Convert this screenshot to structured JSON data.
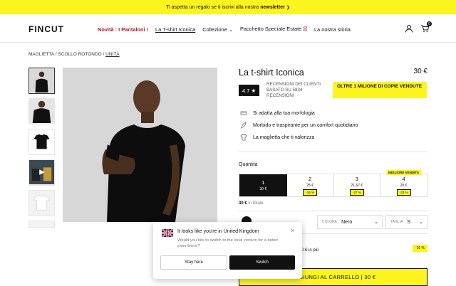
{
  "promo": {
    "text": "Ti aspetta un regalo se ti iscrivi alla nostra",
    "bold": "newsletter",
    "arrow": "❯"
  },
  "nav": {
    "logo": "FINCUT",
    "items": [
      {
        "label": "Novità : I Pantaloni !"
      },
      {
        "label": "La T-shirt Iconica"
      },
      {
        "label": "Collezione"
      },
      {
        "label": "Pacchetto Speciale Estate"
      },
      {
        "label": "La nostra storia"
      }
    ],
    "cart_count": "0"
  },
  "breadcrumb": {
    "part1": "MAGLIETTA / SCOLLO ROTONDO / ",
    "current": "UNITÀ"
  },
  "product": {
    "title": "La t-shirt Iconica",
    "price": "30 €",
    "rating": "4.7 ★",
    "reviews": "RECENSIONI DEI CLIENTI BASATO SU 5834 RECENSIONI",
    "sold_badge": "OLTRE 1 MILIONE DI COPIE VENDUTE",
    "features": [
      "Si adatta alla tua morfologia",
      "Morbido e traspirante per un comfort quotidiano",
      "La maglietta che ti valorizza"
    ]
  },
  "quantity": {
    "label": "Quantità",
    "options": [
      {
        "qty": "1",
        "price": "30 €",
        "discount": ""
      },
      {
        "qty": "2",
        "price": "25 €",
        "discount": "-16 %"
      },
      {
        "qty": "3",
        "price": "21,67 €",
        "discount": "-27 %"
      },
      {
        "qty": "4",
        "price": "20 €",
        "discount": "-33 %",
        "badge": "MIGLIORE VENDITA"
      }
    ],
    "total_value": "30 €",
    "total_label": " in totale"
  },
  "selectors": {
    "color_label": "COLORE",
    "color_value": "Nero",
    "size_label": "TAGLIA",
    "size_value": "S"
  },
  "upsell": {
    "price_text": "0 € in più",
    "badge": "-16 %"
  },
  "add_to_cart": "AGGIUNGI AL CARRELLO | 30 €",
  "popup": {
    "title": "It looks like you're in United Kingdom",
    "text": "Would you like to switch to the local version for a better experience?",
    "stay": "Stay here",
    "switch": "Switch"
  }
}
